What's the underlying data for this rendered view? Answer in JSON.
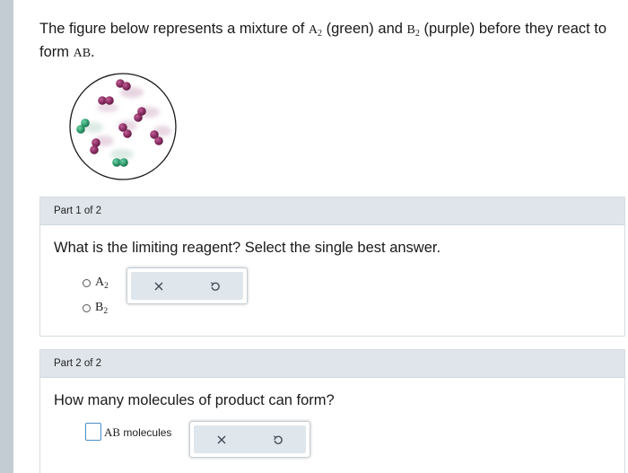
{
  "intro": {
    "text_1": "The figure below represents a mixture of ",
    "reactant_a": "A",
    "reactant_a_sub": "2",
    "text_2": " (green) and ",
    "reactant_b": "B",
    "reactant_b_sub": "2",
    "text_3": " (purple) before they react to form ",
    "product": "AB",
    "text_4": "."
  },
  "colors": {
    "green": "#2f9b6e",
    "purple": "#8a2d62",
    "header_bg": "#dfe5ea",
    "toolbar_bg": "#dfe6ec"
  },
  "part1": {
    "header": "Part 1 of 2",
    "question": "What is the limiting reagent? Select the single best answer.",
    "options": [
      {
        "symbol": "A",
        "sub": "2"
      },
      {
        "symbol": "B",
        "sub": "2"
      }
    ],
    "toolbar": {
      "clear_icon": "x-icon",
      "undo_icon": "undo-icon"
    }
  },
  "part2": {
    "header": "Part 2 of 2",
    "question": "How many molecules of product can form?",
    "answer_value": "",
    "unit_symbol": "AB",
    "unit_word": "molecules",
    "toolbar": {
      "clear_icon": "x-icon",
      "undo_icon": "undo-icon"
    }
  }
}
